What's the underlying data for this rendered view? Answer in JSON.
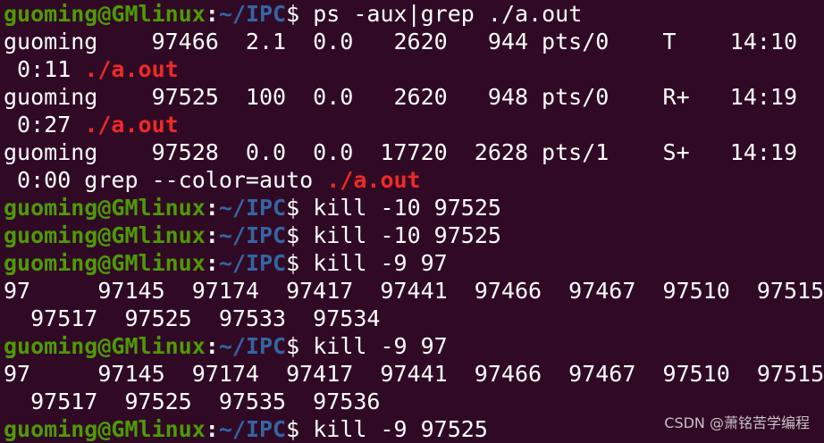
{
  "prompt": {
    "user_host": "guoming@GMlinux",
    "sep": ":",
    "path": "~/IPC",
    "dollar": "$"
  },
  "lines": [
    {
      "type": "prompt",
      "cmd": " ps -aux|grep ./a.out"
    },
    {
      "type": "text",
      "text": "guoming    97466  2.1  0.0   2620   944 pts/0    T    14:10"
    },
    {
      "type": "text_match",
      "text": " 0:11 ",
      "match": "./a.out"
    },
    {
      "type": "text",
      "text": "guoming    97525  100  0.0   2620   948 pts/0    R+   14:19"
    },
    {
      "type": "text_match",
      "text": " 0:27 ",
      "match": "./a.out"
    },
    {
      "type": "text",
      "text": "guoming    97528  0.0  0.0  17720  2628 pts/1    S+   14:19"
    },
    {
      "type": "text_match",
      "text": " 0:00 grep --color=auto ",
      "match": "./a.out"
    },
    {
      "type": "prompt",
      "cmd": " kill -10 97525"
    },
    {
      "type": "prompt",
      "cmd": " kill -10 97525"
    },
    {
      "type": "prompt",
      "cmd": " kill -9 97"
    },
    {
      "type": "text",
      "text": "97     97145  97174  97417  97441  97466  97467  97510  97515"
    },
    {
      "type": "text",
      "text": "  97517  97525  97533  97534"
    },
    {
      "type": "prompt",
      "cmd": " kill -9 97"
    },
    {
      "type": "text",
      "text": "97     97145  97174  97417  97441  97466  97467  97510  97515"
    },
    {
      "type": "text",
      "text": "  97517  97525  97535  97536"
    },
    {
      "type": "prompt",
      "cmd": " kill -9 97525"
    }
  ],
  "watermark": "CSDN @萧铭苦学编程"
}
